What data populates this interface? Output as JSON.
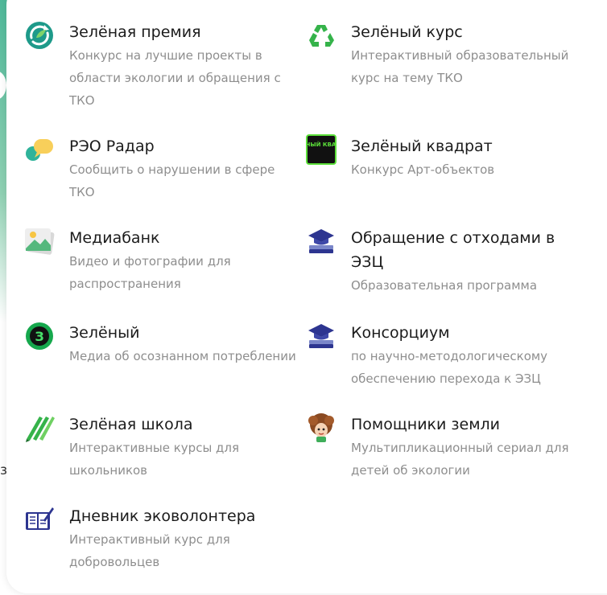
{
  "backdrop": {
    "fragment": "з"
  },
  "menu": {
    "items": [
      {
        "id": "green-prize",
        "title": "Зелёная премия",
        "subtitle": "Конкурс на лучшие проекты в области экологии и обращения с ТКО",
        "icon": "green-refresh-circle-icon"
      },
      {
        "id": "green-course",
        "title": "Зелёный курс",
        "subtitle": "Интерактивный образовательный курс на тему ТКО",
        "icon": "recycle-icon"
      },
      {
        "id": "reo-radar",
        "title": "РЭО Радар",
        "subtitle": "Сообщить о нарушении в сфере ТКО",
        "icon": "chat-bubbles-icon"
      },
      {
        "id": "green-square",
        "title": "Зелёный квадрат",
        "subtitle": "Конкурс Арт-объектов",
        "icon": "green-square-logo-icon",
        "logo_text": "ЗЕЛЁ НЫЙ КВАД РАТ"
      },
      {
        "id": "mediabank",
        "title": "Медиабанк",
        "subtitle": "Видео и фотографии для распространения",
        "icon": "image-gallery-icon"
      },
      {
        "id": "waste-ezc",
        "title": "Обращение с отходами в ЭЗЦ",
        "subtitle": "Образовательная программа",
        "icon": "graduation-cap-books-icon"
      },
      {
        "id": "green-media",
        "title": "Зелёный",
        "subtitle": "Медиа об осознанном потреблении",
        "icon": "letter-z-badge-icon",
        "logo_text": "З"
      },
      {
        "id": "consortium",
        "title": "Консорциум",
        "subtitle": "по научно-методологическому обеспечению перехода к ЭЗЦ",
        "icon": "graduation-cap-books-icon"
      },
      {
        "id": "green-school",
        "title": "Зелёная школа",
        "subtitle": "Интерактивные курсы для школьников",
        "icon": "pencils-icon"
      },
      {
        "id": "earth-helpers",
        "title": "Помощники земли",
        "subtitle": "Мультипликационный сериал для детей об экологии",
        "icon": "cartoon-character-icon"
      },
      {
        "id": "eco-volunteer-diary",
        "title": "Дневник эковолонтера",
        "subtitle": "Интерактивный курс для добровольцев",
        "icon": "notebook-pen-icon"
      }
    ]
  },
  "colors": {
    "title": "#1b1b1b",
    "subtitle": "#8e8e8e",
    "brand_green": "#22b04b",
    "brand_teal": "#1e9a8a",
    "accent_navy": "#2d3590"
  }
}
